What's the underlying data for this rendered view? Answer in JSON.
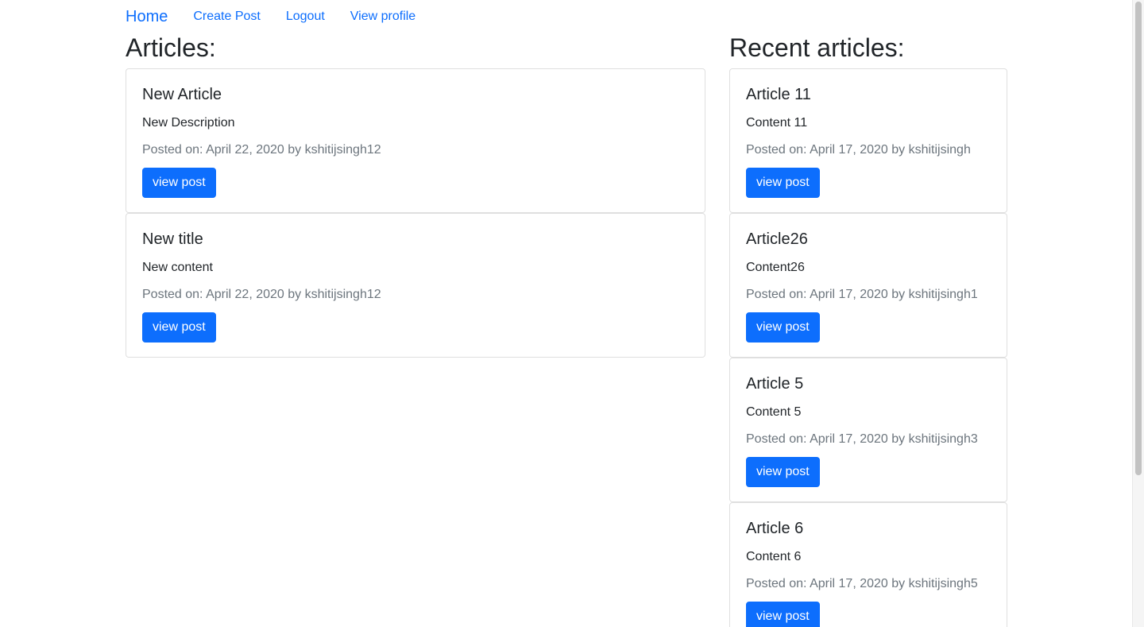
{
  "nav": {
    "brand": "Home",
    "items": [
      "Create Post",
      "Logout",
      "View profile"
    ]
  },
  "articles": {
    "heading": "Articles:",
    "cards": [
      {
        "title": "New Article",
        "text": "New Description",
        "meta": "Posted on: April 22, 2020 by kshitijsingh12",
        "button": "view post"
      },
      {
        "title": "New title",
        "text": "New content",
        "meta": "Posted on: April 22, 2020 by kshitijsingh12",
        "button": "view post"
      }
    ]
  },
  "recent": {
    "heading": "Recent articles:",
    "cards": [
      {
        "title": "Article 11",
        "text": "Content 11",
        "meta": "Posted on: April 17, 2020 by kshitijsingh",
        "button": "view post"
      },
      {
        "title": "Article26",
        "text": "Content26",
        "meta": "Posted on: April 17, 2020 by kshitijsingh1",
        "button": "view post"
      },
      {
        "title": "Article 5",
        "text": "Content 5",
        "meta": "Posted on: April 17, 2020 by kshitijsingh3",
        "button": "view post"
      },
      {
        "title": "Article 6",
        "text": "Content 6",
        "meta": "Posted on: April 17, 2020 by kshitijsingh5",
        "button": "view post"
      }
    ]
  },
  "colors": {
    "link": "#0d6efd",
    "button": "#0d6efd",
    "muted": "#6c757d",
    "text": "#212529",
    "border": "#dfdfdf"
  }
}
